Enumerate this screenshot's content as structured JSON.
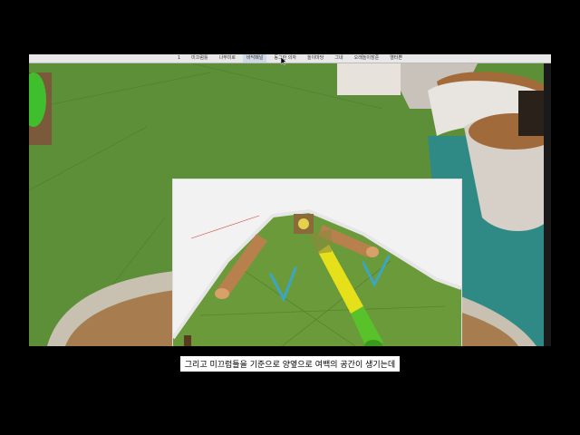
{
  "tabs": [
    {
      "label": "1"
    },
    {
      "label": "미끄럼틀"
    },
    {
      "label": "나무미로"
    },
    {
      "label": "바닥패널"
    },
    {
      "label": "동그란 의자"
    },
    {
      "label": "놀이마당"
    },
    {
      "label": "그네"
    },
    {
      "label": "오래놀이장준"
    },
    {
      "label": "열터쁜"
    }
  ],
  "active_tab_index": 3,
  "subtitle": "그리고 미끄럼틀을 기준으로 양옆으로 여백의 공간이 생기는데",
  "colors": {
    "grass": "#5d8f38",
    "teal_floor": "#2f8a86",
    "sand": "#a77d4f",
    "slide_yellow": "#e6e01a",
    "slide_green": "#59c12a",
    "checkmark": "#3aa6c4"
  }
}
